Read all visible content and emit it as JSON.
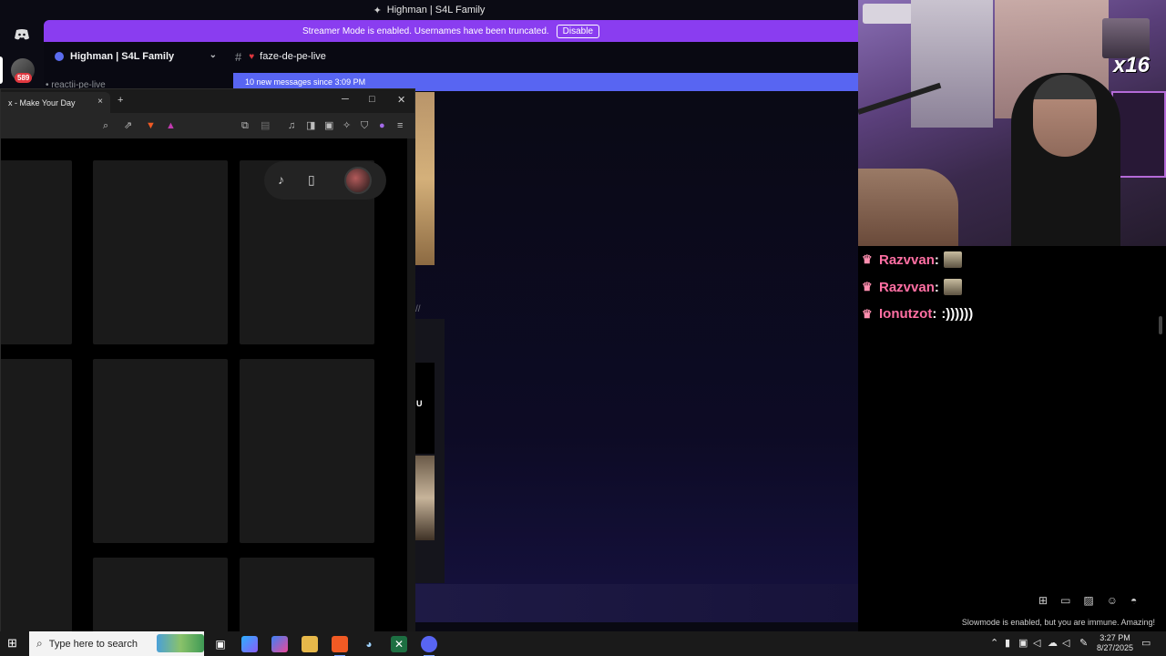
{
  "window_title": "Highman | S4L Family",
  "discord": {
    "notification_count": "589",
    "streamer_banner": "Streamer Mode is enabled. Usernames have been truncated.",
    "disable_button": "Disable",
    "server_name": "Highman | S4L Family",
    "partial_channel": "• reactii-pe-live",
    "current_channel": "faze-de-pe-live",
    "new_messages_bar": "10 new messages since 3:09 PM",
    "partial_letter": "U",
    "partial_mark": "//"
  },
  "browser": {
    "tab_title": "x - Make Your Day",
    "tab_close": "×",
    "new_tab": "+",
    "minimize": "─",
    "maximize": "□",
    "close": "✕",
    "toolbar_icons": [
      "zoom-icon",
      "share-icon",
      "brave-shield-icon",
      "brave-rewards-icon",
      "extensions-icon",
      "reader-icon",
      "music-icon",
      "sidebar-icon",
      "wallet-icon",
      "leo-ai-icon",
      "vpn-icon",
      "profile-icon",
      "menu-icon"
    ],
    "pill_icons": [
      "tiktok-icon",
      "phone-icon",
      "profile-avatar"
    ]
  },
  "stream": {
    "multiplier": "x16",
    "chat": [
      {
        "user": "Razvvan",
        "sep": ":",
        "message": "",
        "emote": true
      },
      {
        "user": "Razvvan",
        "sep": ":",
        "message": "",
        "emote": true
      },
      {
        "user": "Ionutzot",
        "sep": ":",
        "message": ":))))))",
        "emote": false
      }
    ],
    "slowmode_text": "Slowmode is enabled, but you are immune. Amazing!"
  },
  "taskbar": {
    "search_placeholder": "Type here to search",
    "time": "3:27 PM",
    "date": "8/27/2025",
    "apps": [
      "task-view",
      "copilot-icon",
      "copilot-365-icon",
      "file-explorer-icon",
      "brave-icon",
      "steam-icon",
      "excel-icon",
      "discord-icon"
    ]
  }
}
